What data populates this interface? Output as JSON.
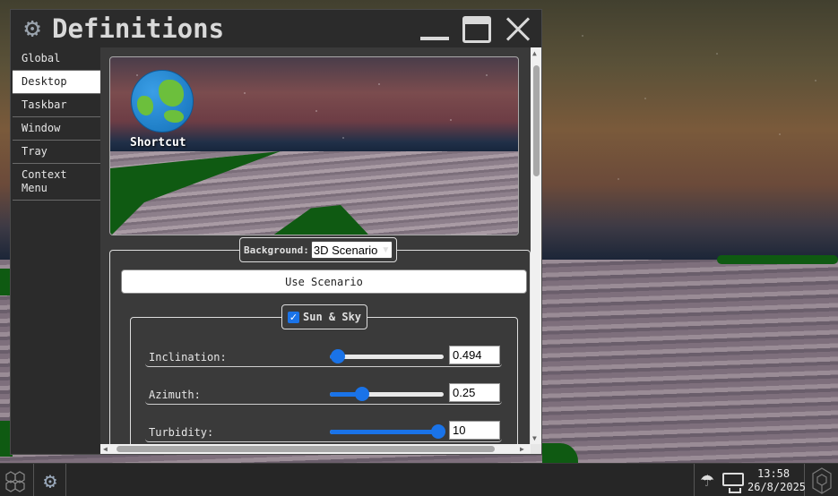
{
  "window": {
    "title": "Definitions",
    "title_icon": "gear-icon"
  },
  "sidebar": {
    "items": [
      {
        "label": "Global",
        "active": false
      },
      {
        "label": "Desktop",
        "active": true
      },
      {
        "label": "Taskbar",
        "active": false
      },
      {
        "label": "Window",
        "active": false
      },
      {
        "label": "Tray",
        "active": false
      },
      {
        "label": "Context Menu",
        "active": false
      }
    ]
  },
  "preview": {
    "shortcut_label": "Shortcut",
    "shortcut_icon": "globe-icon"
  },
  "background": {
    "label": "Background:",
    "selected": "3D Scenario",
    "use_button": "Use Scenario"
  },
  "sun_sky": {
    "label": "Sun & Sky",
    "checked": true,
    "params": [
      {
        "label": "Inclination:",
        "value": "0.494",
        "fraction": 0.07
      },
      {
        "label": "Azimuth:",
        "value": "0.25",
        "fraction": 0.28
      },
      {
        "label": "Turbidity:",
        "value": "10",
        "fraction": 0.95
      }
    ]
  },
  "taskbar": {
    "start_icon": "honeycomb-icon",
    "app_icon": "gear-icon",
    "tray_icons": [
      "umbrella-icon",
      "monitor-icon"
    ],
    "time": "13:58",
    "date": "26/8/2025",
    "show_desktop_icon": "hexagon-icon"
  },
  "colors": {
    "accent": "#1a73e8",
    "window_bg": "#2b2b2b",
    "content_bg": "#3a3a3a",
    "taskbar_bg": "#262626"
  }
}
